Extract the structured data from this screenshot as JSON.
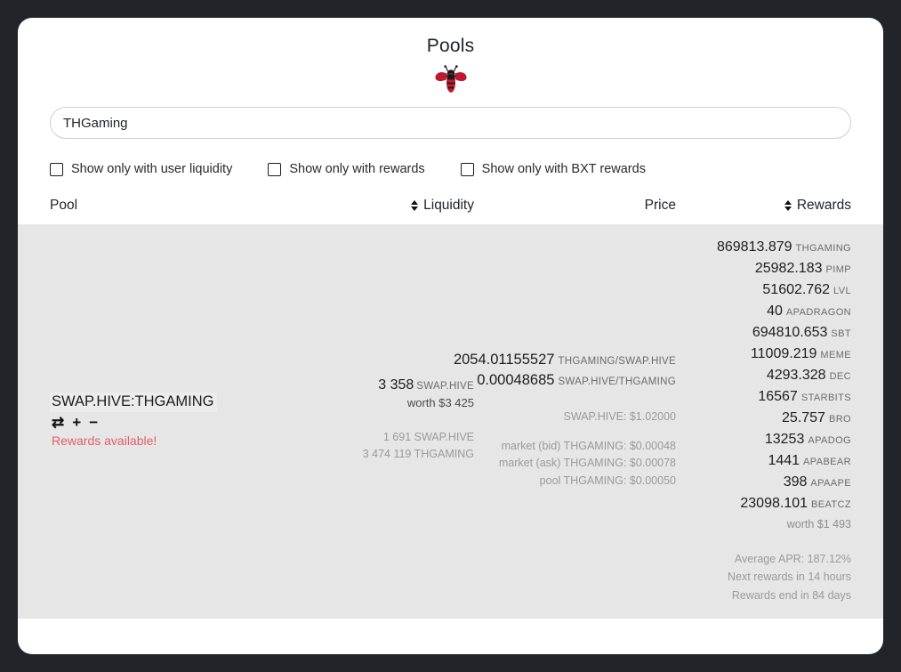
{
  "header": {
    "title": "Pools",
    "logo_icon": "bee-icon"
  },
  "search": {
    "value": "THGaming",
    "placeholder": ""
  },
  "filters": [
    {
      "label": "Show only with user liquidity",
      "checked": false
    },
    {
      "label": "Show only with rewards",
      "checked": false
    },
    {
      "label": "Show only with BXT rewards",
      "checked": false
    }
  ],
  "table": {
    "headers": {
      "pool": "Pool",
      "liquidity": "Liquidity",
      "price": "Price",
      "rewards": "Rewards"
    },
    "sortable": {
      "liquidity": true,
      "rewards": true
    }
  },
  "row": {
    "pool": {
      "name": "SWAP.HIVE:THGAMING",
      "actions": {
        "swap": "⇄",
        "add": "+",
        "remove": "−"
      },
      "rewards_available": "Rewards available!",
      "rewards_available_color": "#e35d6a"
    },
    "liquidity": {
      "amount": "3 358",
      "unit": "SWAP.HIVE",
      "worth": "worth $3 425",
      "base_line": "1 691 SWAP.HIVE",
      "quote_line": "3 474 119 THGAMING"
    },
    "price": {
      "rate_a_value": "2054.01155527",
      "rate_a_unit": "THGAMING/SWAP.HIVE",
      "rate_b_value": "0.00048685",
      "rate_b_unit": "SWAP.HIVE/THGAMING",
      "hive_usd": "SWAP.HIVE: $1.02000",
      "market_bid": "market (bid) THGAMING: $0.00048",
      "market_ask": "market (ask) THGAMING: $0.00078",
      "pool_price": "pool THGAMING: $0.00050"
    },
    "rewards": {
      "tokens": [
        {
          "amount": "869813.879",
          "symbol": "THGAMING"
        },
        {
          "amount": "25982.183",
          "symbol": "PIMP"
        },
        {
          "amount": "51602.762",
          "symbol": "LVL"
        },
        {
          "amount": "40",
          "symbol": "APADRAGON"
        },
        {
          "amount": "694810.653",
          "symbol": "SBT"
        },
        {
          "amount": "11009.219",
          "symbol": "MEME"
        },
        {
          "amount": "4293.328",
          "symbol": "DEC"
        },
        {
          "amount": "16567",
          "symbol": "STARBITS"
        },
        {
          "amount": "25.757",
          "symbol": "BRO"
        },
        {
          "amount": "13253",
          "symbol": "APADOG"
        },
        {
          "amount": "1441",
          "symbol": "APABEAR"
        },
        {
          "amount": "398",
          "symbol": "APAAPE"
        },
        {
          "amount": "23098.101",
          "symbol": "BEATCZ"
        }
      ],
      "worth": "worth $1 493",
      "average_apr": "Average APR: 187.12%",
      "next_rewards": "Next rewards in 14 hours",
      "rewards_end": "Rewards end in 84 days"
    }
  },
  "theme": {
    "page_background": "#212529",
    "card_background": "#ffffff",
    "row_background": "#e6e6e6",
    "accent_red": "#e35d6a",
    "logo_red": "#c0182e"
  }
}
